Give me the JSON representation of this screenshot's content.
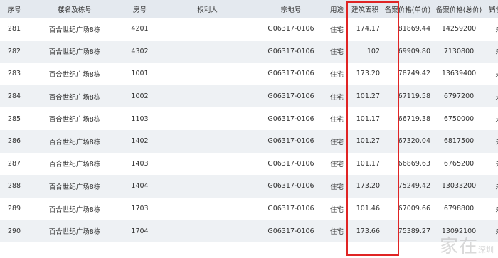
{
  "headers": [
    "序号",
    "楼名及栋号",
    "房号",
    "权利人",
    "宗地号",
    "用途",
    "建筑面积",
    "备案价格(单价)",
    "备案价格(总价)",
    "销售状态"
  ],
  "rows": [
    [
      "281",
      "百合世纪广场8栋",
      "4201",
      "",
      "G06317-0106",
      "住宅",
      "174.17",
      "81869.44",
      "14259200",
      "未售"
    ],
    [
      "282",
      "百合世纪广场8栋",
      "4302",
      "",
      "G06317-0106",
      "住宅",
      "102",
      "69909.80",
      "7130800",
      "未售"
    ],
    [
      "283",
      "百合世纪广场8栋",
      "1001",
      "",
      "G06317-0106",
      "住宅",
      "173.20",
      "78749.42",
      "13639400",
      "未售"
    ],
    [
      "284",
      "百合世纪广场8栋",
      "1002",
      "",
      "G06317-0106",
      "住宅",
      "101.27",
      "67119.58",
      "6797200",
      "未售"
    ],
    [
      "285",
      "百合世纪广场8栋",
      "1103",
      "",
      "G06317-0106",
      "住宅",
      "101.17",
      "66719.38",
      "6750000",
      "未售"
    ],
    [
      "286",
      "百合世纪广场8栋",
      "1402",
      "",
      "G06317-0106",
      "住宅",
      "101.27",
      "67320.04",
      "6817500",
      "未售"
    ],
    [
      "287",
      "百合世纪广场8栋",
      "1403",
      "",
      "G06317-0106",
      "住宅",
      "101.17",
      "66869.63",
      "6765200",
      "未售"
    ],
    [
      "288",
      "百合世纪广场8栋",
      "1404",
      "",
      "G06317-0106",
      "住宅",
      "173.20",
      "75249.42",
      "13033200",
      "未售"
    ],
    [
      "289",
      "百合世纪广场8栋",
      "1703",
      "",
      "G06317-0106",
      "住宅",
      "101.46",
      "67009.66",
      "6798800",
      "未售"
    ],
    [
      "290",
      "百合世纪广场8栋",
      "1704",
      "",
      "G06317-0106",
      "住宅",
      "173.66",
      "75389.27",
      "13092100",
      "未售"
    ]
  ],
  "watermark": {
    "text": "家在",
    "sub": "深圳"
  },
  "colors": {
    "header_bg": "#e4e9ef",
    "stripe": "#eef1f4",
    "highlight": "#e02424"
  }
}
